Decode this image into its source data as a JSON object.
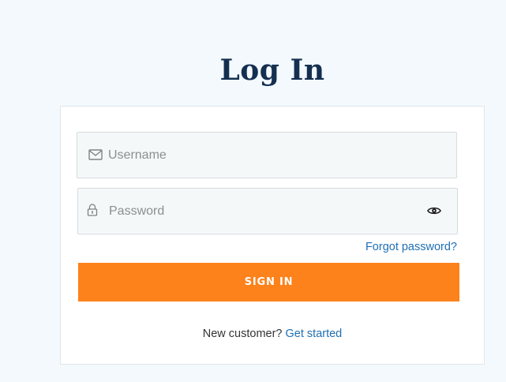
{
  "page": {
    "title": "Log In"
  },
  "login_form": {
    "username": {
      "placeholder": "Username",
      "value": "",
      "icon": "envelope-icon"
    },
    "password": {
      "placeholder": "Password",
      "value": "",
      "icon": "lock-icon",
      "toggle_icon": "eye-icon"
    },
    "forgot_password_label": "Forgot password?",
    "sign_in_label": "SIGN IN",
    "signup_prompt": "New customer?",
    "signup_link_label": "Get started"
  },
  "colors": {
    "background": "#f3f9fd",
    "title": "#152f50",
    "accent_button": "#fd821b",
    "link": "#1f6fb5"
  }
}
